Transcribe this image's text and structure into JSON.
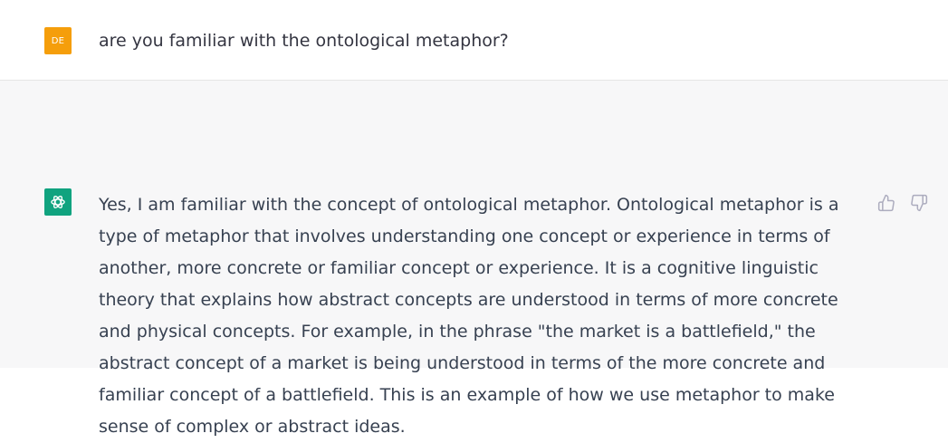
{
  "user_message": {
    "avatar_initials": "DE",
    "avatar_color": "#f59e0b",
    "text": "are you familiar with the ontological metaphor?"
  },
  "assistant_message": {
    "avatar_icon": "openai-logo-icon",
    "avatar_color": "#10a37f",
    "text": "Yes, I am familiar with the concept of ontological metaphor. Ontological metaphor is a type of metaphor that involves understanding one concept or experience in terms of another, more concrete or familiar concept or experience. It is a cognitive linguistic theory that explains how abstract concepts are understood in terms of more concrete and physical concepts. For example, in the phrase \"the market is a battlefield,\" the abstract concept of a market is being understood in terms of the more concrete and familiar concept of a battlefield. This is an example of how we use metaphor to make sense of complex or abstract ideas.",
    "actions": [
      {
        "icon": "thumbs-up-icon"
      },
      {
        "icon": "thumbs-down-icon"
      }
    ]
  },
  "colors": {
    "assistant_background": "#f7f7f8",
    "text": "#374151",
    "icon": "#acacbe"
  }
}
